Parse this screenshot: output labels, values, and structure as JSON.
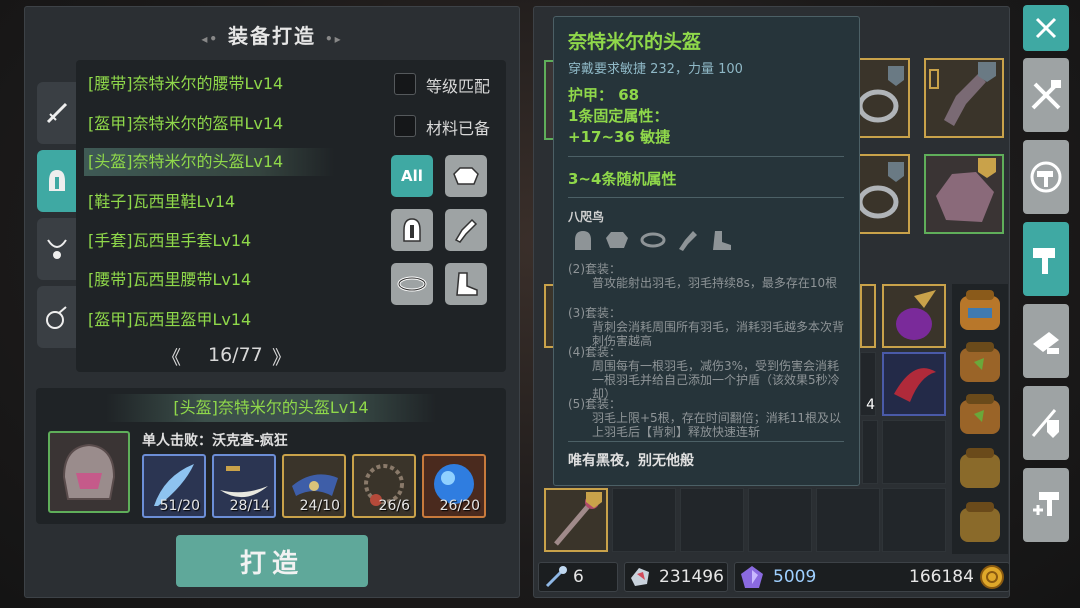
{
  "forge": {
    "title": "装备打造",
    "items": [
      "[腰带]奈特米尔的腰带Lv14",
      "[盔甲]奈特米尔的盔甲Lv14",
      "[头盔]奈特米尔的头盔Lv14",
      "[鞋子]瓦西里鞋Lv14",
      "[手套]瓦西里手套Lv14",
      "[腰带]瓦西里腰带Lv14",
      "[盔甲]瓦西里盔甲Lv14"
    ],
    "selected_index": 2,
    "checkbox_level": "等级匹配",
    "checkbox_material": "材料已备",
    "filter_all": "All",
    "pager": "16/77",
    "selected_name": "[头盔]奈特米尔的头盔Lv14",
    "drop_source": "单人击败：沃克查-疯狂",
    "materials": [
      "51/20",
      "28/14",
      "24/10",
      "26/6",
      "26/20"
    ],
    "forge_button": "打造"
  },
  "tooltip": {
    "name": "奈特米尔的头盔",
    "requirement": "穿戴要求敏捷 232，力量 100",
    "armor": "护甲：  68",
    "fixed_attr_label": "1条固定属性：",
    "fixed_attr": "+17~36 敏捷",
    "random_attr": "3~4条随机属性",
    "set_name": "八咫鸟",
    "set_bonus": [
      "(2)套装：",
      "普攻能射出羽毛，羽毛持续8s，最多存在10根",
      "(3)套装：",
      "背刺会消耗周围所有羽毛，消耗羽毛越多本次背刺伤害越高",
      "(4)套装：",
      "周围每有一根羽毛，减伤3%，受到伤害会消耗一根羽毛并给自己添加一个护盾（该效果5秒冷却）",
      "(5)套装：",
      "羽毛上限+5根，存在时间翻倍；消耗11根及以上羽毛后【背刺】释放快速连斩"
    ],
    "flavor": "唯有黑夜，别无他般"
  },
  "inventory": {
    "mid_count": "4"
  },
  "bottom_bar": {
    "keys": "6",
    "shards": "231496",
    "gems": "5009",
    "gold": "166184"
  }
}
